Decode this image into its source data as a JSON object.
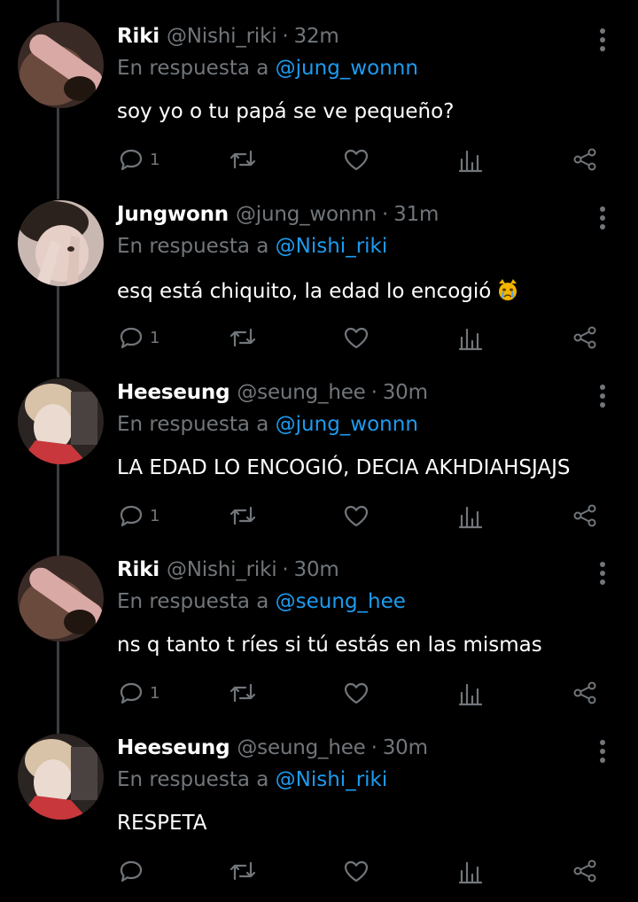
{
  "colors": {
    "background": "#000000",
    "name": "#ffffff",
    "muted": "#71767b",
    "mention": "#1d9bf0",
    "thread_line": "#3a3d41"
  },
  "thread": {
    "replying_prefix": "En respuesta a",
    "tweets": [
      {
        "name": "Riki",
        "handle": "@Nishi_riki",
        "time": "32m",
        "reply_to": "@jung_wonnn",
        "text": "soy yo o tu papá se ve pequeño?",
        "reply_count": "1",
        "emoji": "",
        "avatar_icon": "riki-avatar"
      },
      {
        "name": "Jungwonn",
        "handle": "@jung_wonnn",
        "time": "31m",
        "reply_to": "@Nishi_riki",
        "text": "esq está chiquito, la edad lo encogió",
        "reply_count": "1",
        "emoji": "crying-cat-emoji",
        "avatar_icon": "jungwonn-avatar"
      },
      {
        "name": "Heeseung",
        "handle": "@seung_hee",
        "time": "30m",
        "reply_to": "@jung_wonnn",
        "text": "LA EDAD LO ENCOGIÓ, DECIA AKHDIAHSJAJS",
        "reply_count": "1",
        "emoji": "",
        "avatar_icon": "heeseung-avatar"
      },
      {
        "name": "Riki",
        "handle": "@Nishi_riki",
        "time": "30m",
        "reply_to": "@seung_hee",
        "text": "ns q tanto t ríes si tú estás en las mismas",
        "reply_count": "1",
        "emoji": "",
        "avatar_icon": "riki-avatar"
      },
      {
        "name": "Heeseung",
        "handle": "@seung_hee",
        "time": "30m",
        "reply_to": "@Nishi_riki",
        "text": "RESPETA",
        "reply_count": "",
        "emoji": "",
        "avatar_icon": "heeseung-avatar"
      }
    ]
  }
}
